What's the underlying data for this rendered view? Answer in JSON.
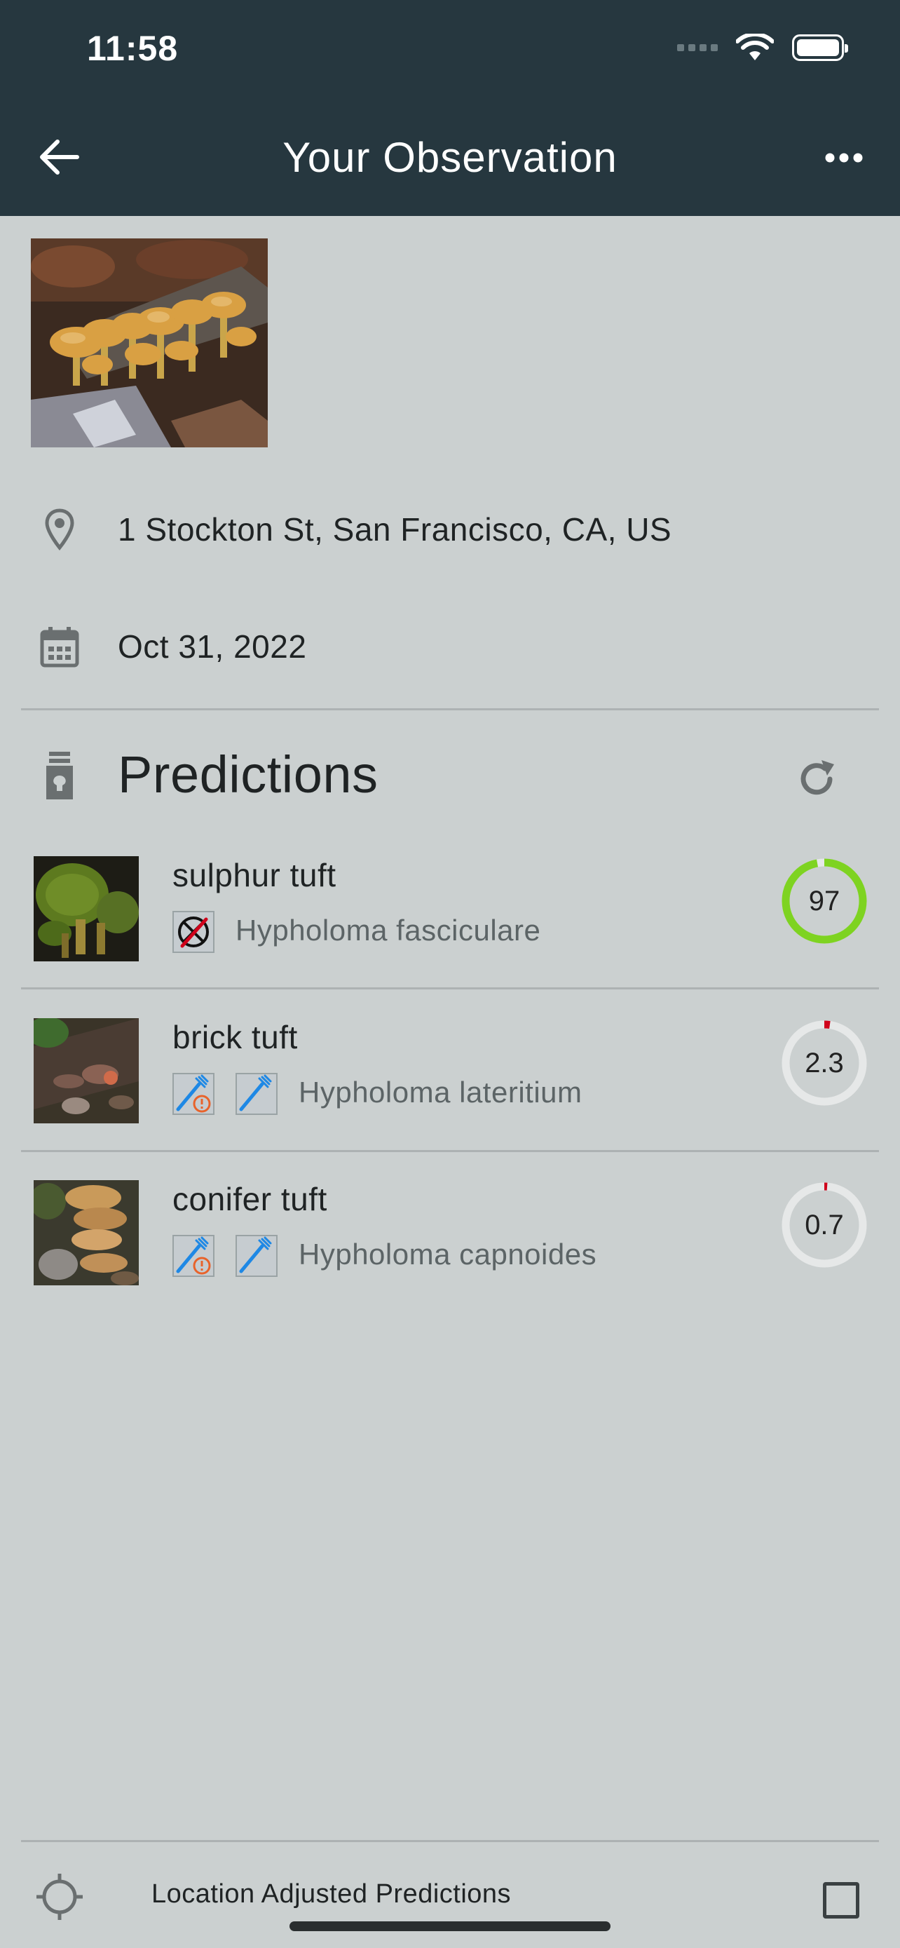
{
  "status_bar": {
    "time": "11:58"
  },
  "nav": {
    "title": "Your Observation"
  },
  "observation": {
    "location": "1 Stockton St, San Francisco, CA, US",
    "date": "Oct 31, 2022"
  },
  "predictions": {
    "title": "Predictions",
    "items": [
      {
        "common_name": "sulphur tuft",
        "scientific_name": "Hypholoma fasciculare",
        "score_label": "97",
        "score": 97,
        "ring_color": "#7ed321",
        "badges": [
          "poisonous-icon"
        ]
      },
      {
        "common_name": "brick tuft",
        "scientific_name": "Hypholoma lateritium",
        "score_label": "2.3",
        "score": 2.3,
        "ring_color": "#d0021b",
        "badges": [
          "edible-caution-icon",
          "edible-icon"
        ]
      },
      {
        "common_name": "conifer tuft",
        "scientific_name": "Hypholoma capnoides",
        "score_label": "0.7",
        "score": 0.7,
        "ring_color": "#d0021b",
        "badges": [
          "edible-caution-icon",
          "edible-icon"
        ]
      }
    ]
  },
  "footer": {
    "toggle_label": "Location Adjusted Predictions",
    "checked": false
  },
  "colors": {
    "header_bg": "#26373f",
    "page_bg": "#cbd0d0",
    "fork_blue": "#1e88e5",
    "warning_orange": "#e8632b"
  }
}
